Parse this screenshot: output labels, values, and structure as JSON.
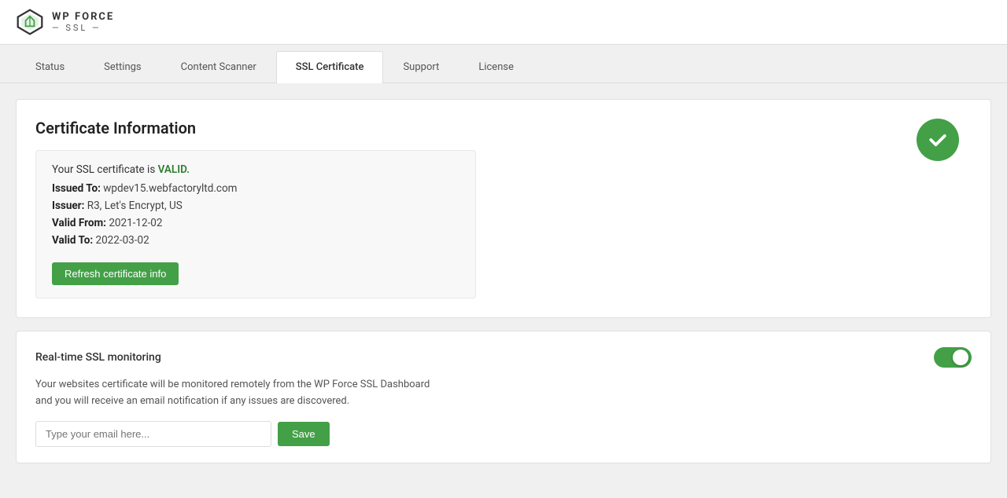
{
  "brand": {
    "name_line1": "WP FORCE",
    "name_line2": "— SSL —"
  },
  "tabs": [
    {
      "id": "status",
      "label": "Status",
      "active": false
    },
    {
      "id": "settings",
      "label": "Settings",
      "active": false
    },
    {
      "id": "content-scanner",
      "label": "Content Scanner",
      "active": false
    },
    {
      "id": "ssl-certificate",
      "label": "SSL Certificate",
      "active": true
    },
    {
      "id": "support",
      "label": "Support",
      "active": false
    },
    {
      "id": "license",
      "label": "License",
      "active": false
    }
  ],
  "certificate_section": {
    "title": "Certificate Information",
    "status_prefix": "Your SSL certificate is ",
    "status_value": "VALID.",
    "issued_to_label": "Issued To:",
    "issued_to_value": "wpdev15.webfactoryltd.com",
    "issuer_label": "Issuer:",
    "issuer_value": "R3, Let's Encrypt, US",
    "valid_from_label": "Valid From:",
    "valid_from_value": "2021-12-02",
    "valid_to_label": "Valid To:",
    "valid_to_value": "2022-03-02",
    "refresh_button": "Refresh certificate info"
  },
  "monitoring_section": {
    "label": "Real-time SSL monitoring",
    "toggle_on": true,
    "description": "Your websites certificate will be monitored remotely from the WP Force SSL Dashboard and you will receive an email notification if any issues are discovered.",
    "email_placeholder": "Type your email here...",
    "save_button": "Save"
  },
  "colors": {
    "green": "#43a047",
    "valid_text": "#2e7d32"
  }
}
